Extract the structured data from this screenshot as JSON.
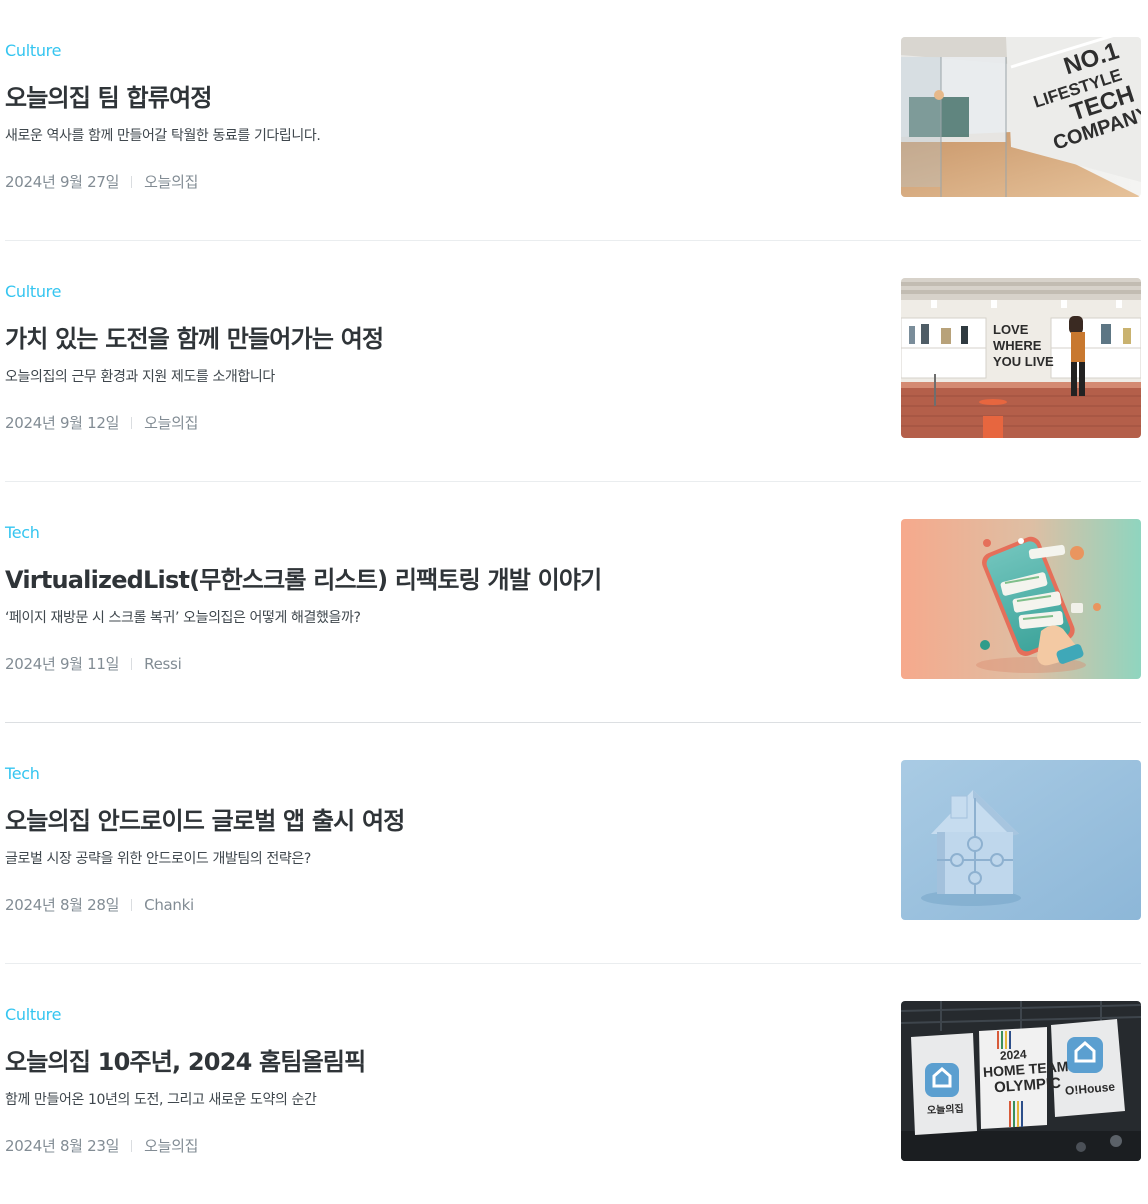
{
  "posts": [
    {
      "category": "Culture",
      "title": "오늘의집 팀 합류여정",
      "description": "새로운 역사를 함께 만들어갈 탁월한 동료를 기다립니다.",
      "date": "2024년 9월 27일",
      "author": "오늘의집",
      "thumbnail": {
        "icon": "office-wall-photo",
        "text_lines": [
          "NO.1",
          "LIFESTYLE",
          "TECH",
          "COMPANY"
        ]
      }
    },
    {
      "category": "Culture",
      "title": "가치 있는 도전을 함께 만들어가는 여정",
      "description": "오늘의집의 근무 환경과 지원 제도를 소개합니다",
      "date": "2024년 9월 12일",
      "author": "오늘의집",
      "thumbnail": {
        "icon": "lounge-photo",
        "text_lines": [
          "LOVE",
          "WHERE",
          "YOU LIVE"
        ]
      }
    },
    {
      "category": "Tech",
      "title": "VirtualizedList(무한스크롤 리스트) 리팩토링 개발 이야기",
      "description": "‘페이지 재방문 시 스크롤 복귀’ 오늘의집은 어떻게 해결했을까?",
      "date": "2024년 9월 11일",
      "author": "Ressi",
      "thumbnail": {
        "icon": "phone-scroll-illustration",
        "text_lines": []
      }
    },
    {
      "category": "Tech",
      "title": "오늘의집 안드로이드 글로벌 앱 출시 여정",
      "description": "글로벌 시장 공략을 위한 안드로이드 개발팀의 전략은?",
      "date": "2024년 8월 28일",
      "author": "Chanki",
      "thumbnail": {
        "icon": "puzzle-house-illustration",
        "text_lines": []
      }
    },
    {
      "category": "Culture",
      "title": "오늘의집 10주년, 2024 홈팀올림픽",
      "description": "함께 만들어온 10년의 도전, 그리고 새로운 도약의 순간",
      "date": "2024년 8월 23일",
      "author": "오늘의집",
      "thumbnail": {
        "icon": "banners-photo",
        "text_lines": [
          "2024",
          "HOME TEAM",
          "OLYMPIC",
          "오늘의집",
          "O!House"
        ]
      }
    }
  ],
  "colors": {
    "accent": "#35c5f0",
    "title": "#2f3438",
    "meta": "#828c94"
  }
}
